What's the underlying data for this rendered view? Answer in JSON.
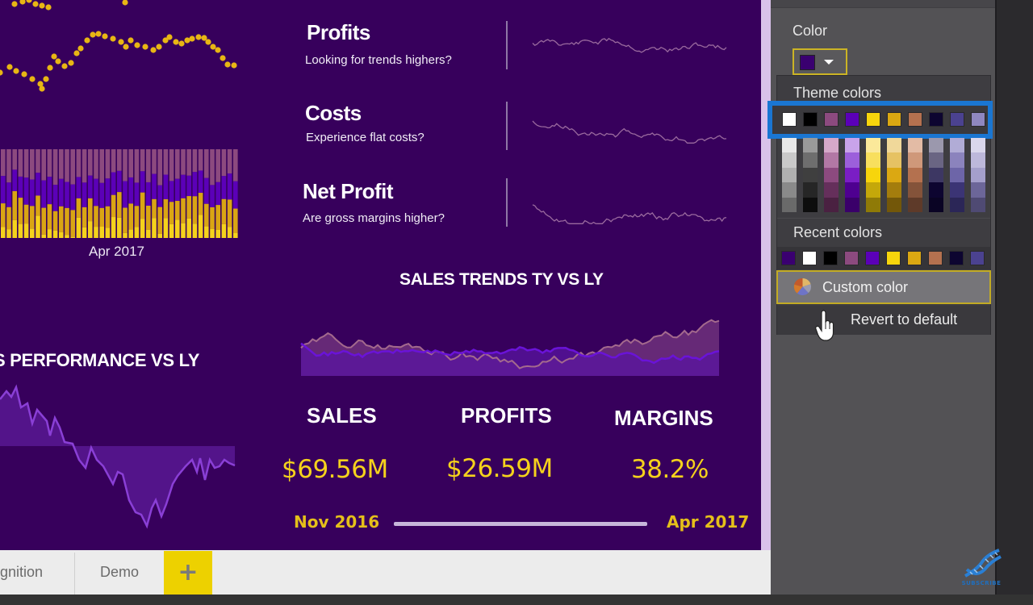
{
  "report": {
    "kpis": [
      {
        "title": "Profits",
        "subtitle": "Looking for trends highers?"
      },
      {
        "title": "Costs",
        "subtitle": "Experience flat costs?"
      },
      {
        "title": "Net Profit",
        "subtitle": "Are gross margins higher?"
      }
    ],
    "bar_chart_axis_label": "Apr 2017",
    "performance_title": "S PERFORMANCE VS LY",
    "sales_trends_title": "SALES TRENDS TY VS LY",
    "cards": [
      {
        "label": "SALES",
        "value": "$69.56M"
      },
      {
        "label": "PROFITS",
        "value": "$26.59M"
      },
      {
        "label": "MARGINS",
        "value": "38.2%"
      }
    ],
    "date_slicer": {
      "start": "Nov 2016",
      "end": "Apr 2017"
    },
    "colors": {
      "background": "#37005c",
      "accent_yellow": "#f5d21c",
      "gold": "#d9a514",
      "mauve": "#8c4a7f",
      "violet": "#5b00b8"
    }
  },
  "tabs": {
    "items": [
      {
        "label": "gnition"
      },
      {
        "label": "Demo"
      }
    ],
    "add_label": "+"
  },
  "format_pane": {
    "color_label": "Color",
    "current_color": "#3a0070",
    "picker": {
      "theme_label": "Theme colors",
      "theme_colors": [
        "#ffffff",
        "#000000",
        "#8c4a7f",
        "#5b00b8",
        "#f7d50c",
        "#dba812",
        "#b4714f",
        "#0d0530",
        "#4b4290",
        "#8f87c0"
      ],
      "shades": [
        [
          "#e8e8e8",
          "#c9c9c9",
          "#b0b0b0",
          "#8a8a8a",
          "#6a6a6a"
        ],
        [
          "#9a9a9a",
          "#6e6e6e",
          "#3f3f3f",
          "#262626",
          "#0d0d0d"
        ],
        [
          "#d5a8c9",
          "#b278a5",
          "#8c4a7f",
          "#652f5b",
          "#4a2141"
        ],
        [
          "#c9a3ea",
          "#9c5fdb",
          "#7a1ec4",
          "#4e0090",
          "#3a006a"
        ],
        [
          "#fbe99a",
          "#f8df5d",
          "#f7d50c",
          "#c4a80a",
          "#8f7a07"
        ],
        [
          "#f0d89a",
          "#e6c263",
          "#dba812",
          "#a47d0d",
          "#735709"
        ],
        [
          "#e3bba5",
          "#cf987a",
          "#b4714f",
          "#84533a",
          "#5e3a29"
        ],
        [
          "#9b98ad",
          "#6a6583",
          "#3d3763",
          "#0d0530",
          "#0a0424"
        ],
        [
          "#b1acd6",
          "#8b83bd",
          "#6d65a8",
          "#3b3475",
          "#2b2657"
        ],
        [
          "#dad7ec",
          "#bdb8db",
          "#a49fcb",
          "#6c6699",
          "#4f4a73"
        ]
      ],
      "recent_label": "Recent colors",
      "recent_colors": [
        "#3a0070",
        "#ffffff",
        "#000000",
        "#8c4a7f",
        "#5b00b8",
        "#f7d50c",
        "#dba812",
        "#b4714f",
        "#0d0530",
        "#4b4290"
      ],
      "custom_color_label": "Custom color",
      "revert_label": "Revert to default"
    }
  },
  "watermark": {
    "label": "SUBSCRIBE"
  }
}
